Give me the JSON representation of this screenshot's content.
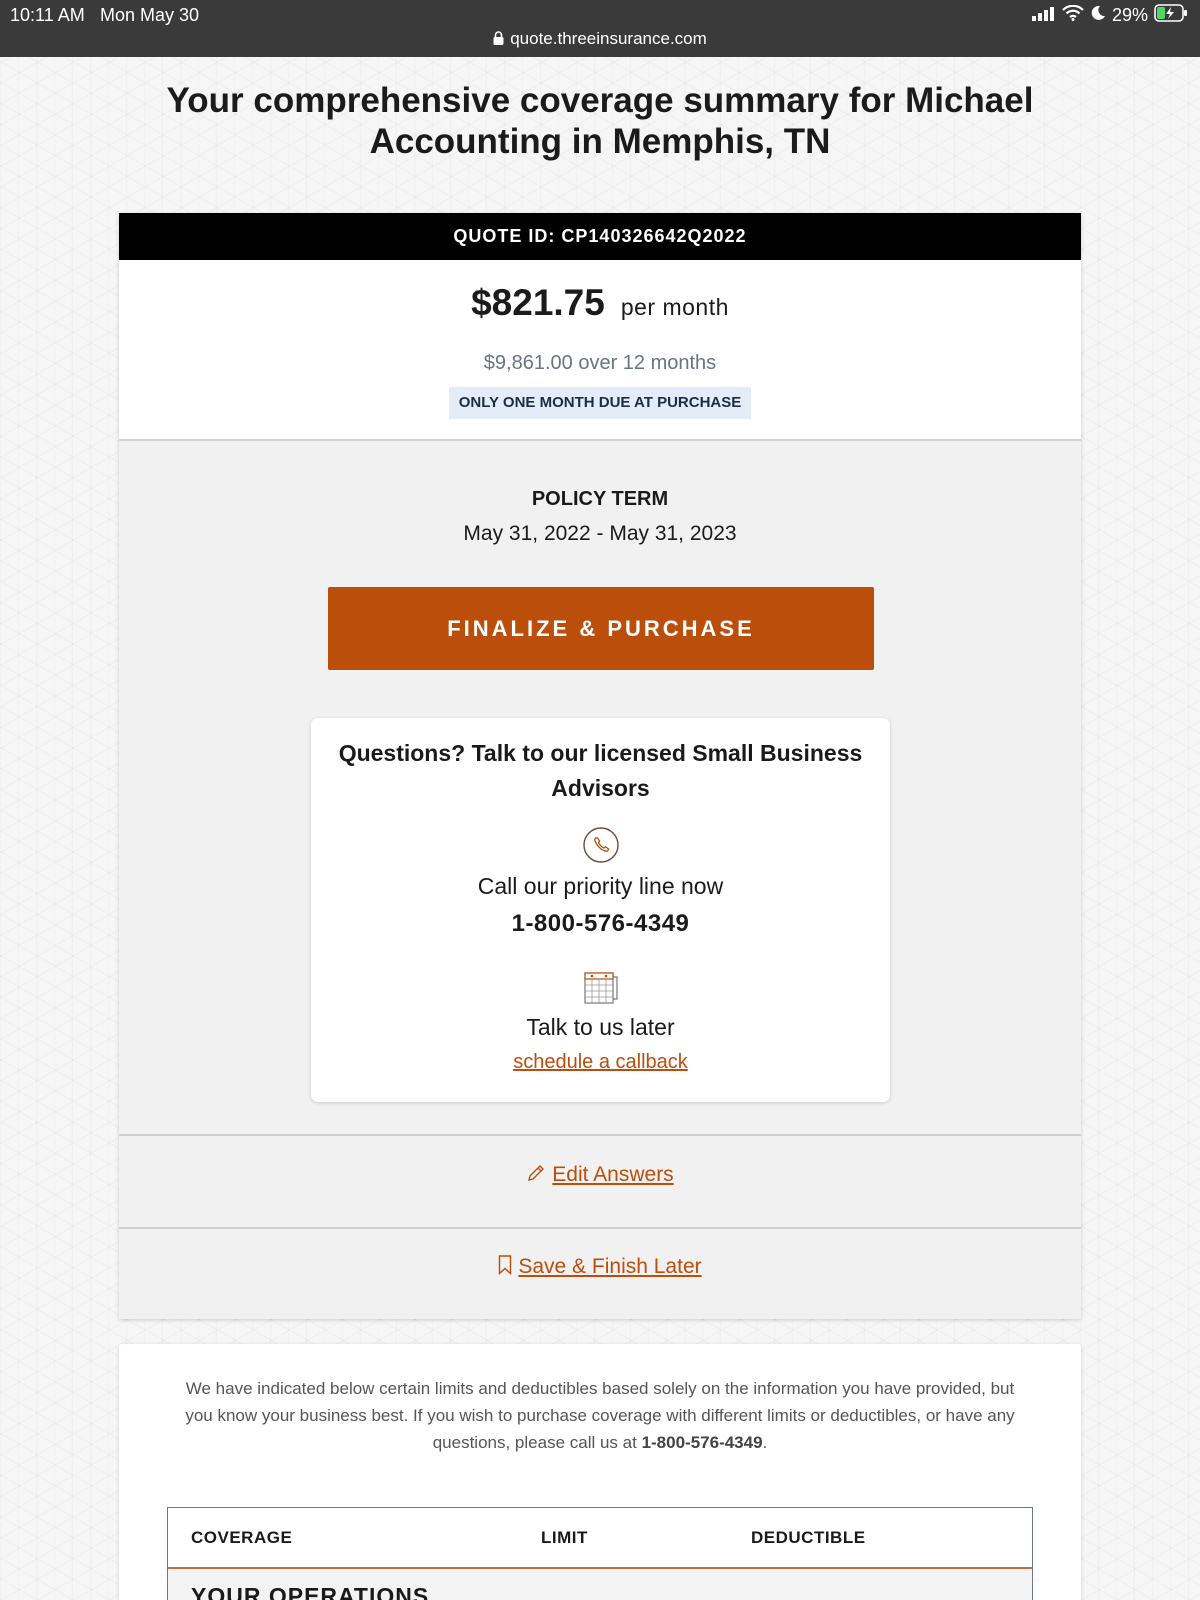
{
  "status_bar": {
    "time": "10:11 AM",
    "date": "Mon May 30",
    "battery": "29%",
    "url": "quote.threeinsurance.com"
  },
  "page_title": "Your comprehensive coverage summary for Michael Accounting in Memphis, TN",
  "quote": {
    "id_label": "QUOTE ID: CP140326642Q2022",
    "monthly_price": "$821.75",
    "monthly_unit": "per month",
    "annual_text": "$9,861.00 over 12 months",
    "due_badge": "ONLY ONE MONTH DUE AT PURCHASE",
    "term_label": "POLICY TERM",
    "term_dates": "May 31, 2022 - May 31, 2023",
    "purchase_button": "FINALIZE & PURCHASE"
  },
  "advisor": {
    "title": "Questions? Talk to our licensed Small Business Advisors",
    "call_label": "Call our priority line now",
    "phone": "1-800-576-4349",
    "later_label": "Talk to us later",
    "callback_link": "schedule a callback"
  },
  "actions": {
    "edit_answers": "Edit Answers",
    "save_finish_later": "Save & Finish Later"
  },
  "coverage": {
    "disclaimer": "We have indicated below certain limits and deductibles based solely on the information you have provided, but you know your business best. If you wish to purchase coverage with different limits or deductibles, or have any questions, please call us at",
    "disclaimer_phone": "1-800-576-4349",
    "disclaimer_end": ".",
    "columns": [
      "COVERAGE",
      "LIMIT",
      "DEDUCTIBLE"
    ],
    "section_label": "YOUR OPERATIONS"
  },
  "colors": {
    "accent": "#bb4e0b",
    "header_bar": "#000000",
    "status_bar": "#3a3a3a",
    "badge_bg": "#e4ecf8"
  },
  "icons": [
    "lock-icon",
    "signal-icon",
    "wifi-icon",
    "moon-icon",
    "battery-icon",
    "phone-icon",
    "calendar-icon",
    "pencil-icon",
    "bookmark-icon"
  ]
}
